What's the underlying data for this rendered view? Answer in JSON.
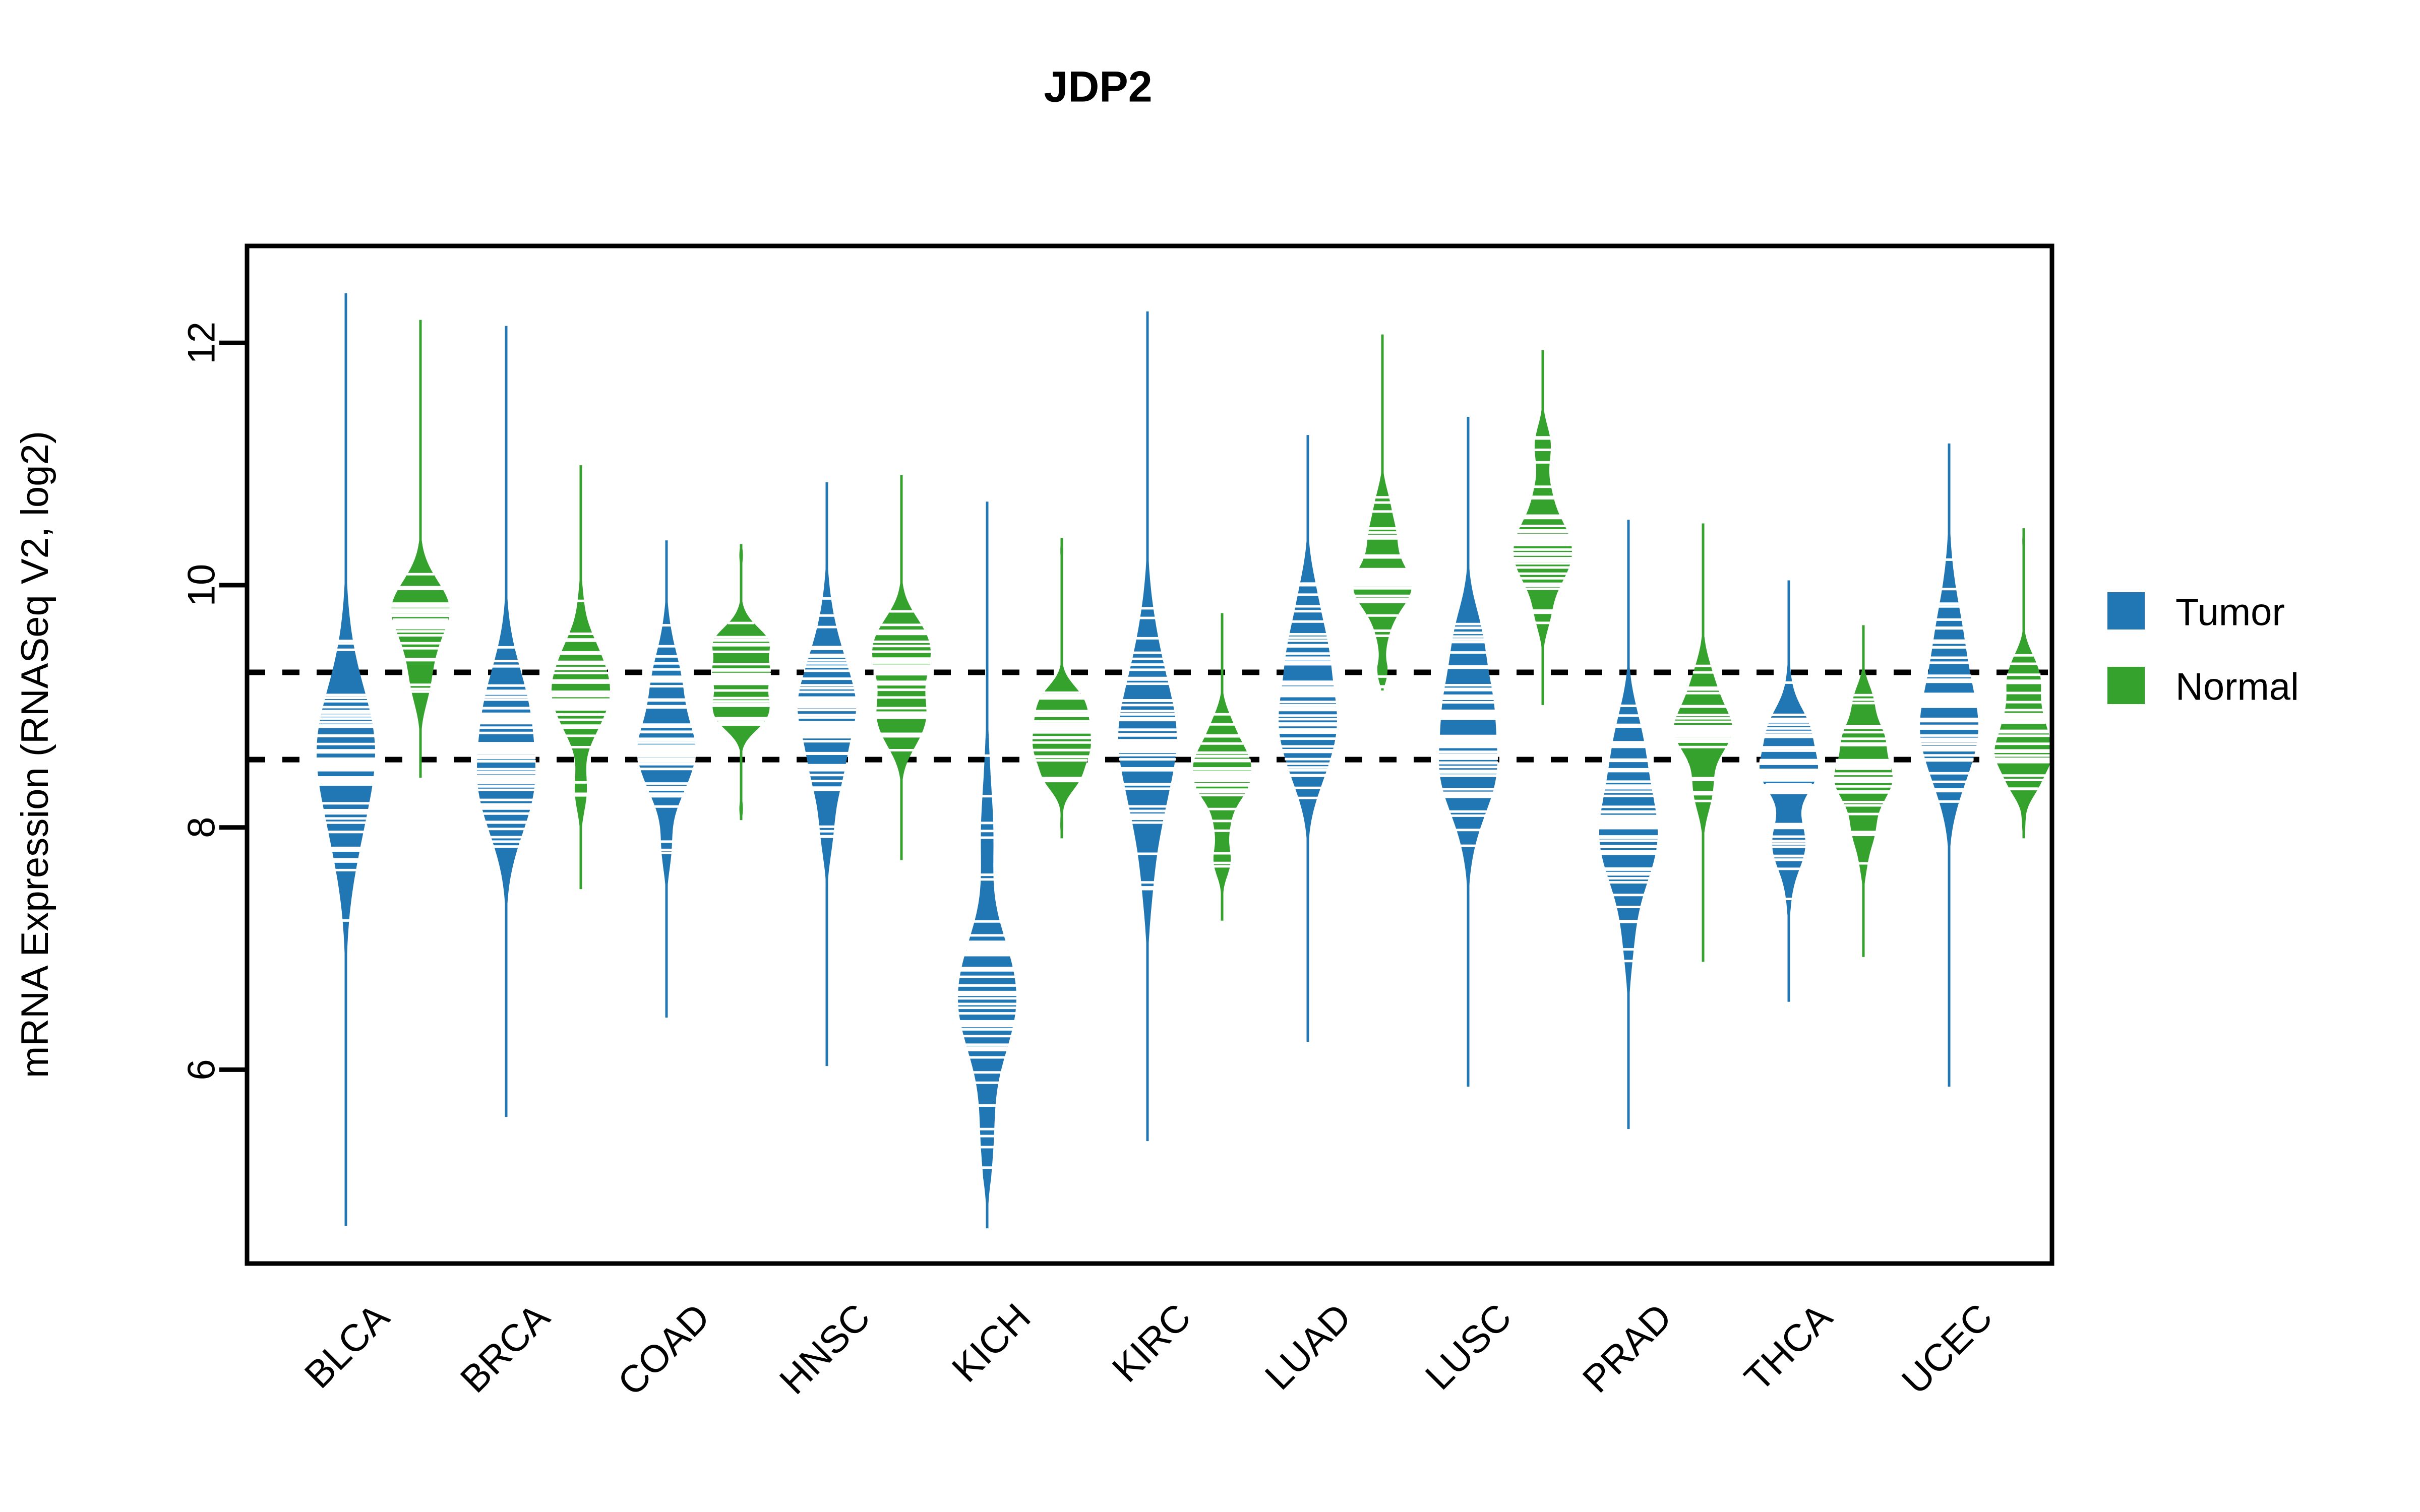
{
  "chart": {
    "title": "JDP2",
    "ylabel": "mRNA Expression (RNASeq V2, log2)",
    "xlabel": ""
  },
  "legend": {
    "position": "right",
    "items": [
      {
        "label": "Tumor",
        "color": "#2077b4"
      },
      {
        "label": "Normal",
        "color": "#34a22c"
      }
    ]
  },
  "axis": {
    "y_ticks": [
      "6",
      "8",
      "10",
      "12"
    ]
  },
  "chart_data": {
    "type": "violin",
    "title": "JDP2",
    "xlabel": "",
    "ylabel": "mRNA Expression (RNASeq V2, log2)",
    "ylim": [
      4.4,
      12.8
    ],
    "yticks": [
      6,
      8,
      10,
      12
    ],
    "grid": false,
    "legend_position": "right",
    "legend": [
      "Tumor",
      "Normal"
    ],
    "colors": {
      "Tumor": "#2077b4",
      "Normal": "#34a22c"
    },
    "reference_lines": [
      {
        "value": 9.28,
        "style": "dashed",
        "color": "#000000"
      },
      {
        "value": 8.56,
        "style": "dashed",
        "color": "#000000"
      }
    ],
    "categories": [
      "BLCA",
      "BRCA",
      "COAD",
      "HNSC",
      "KICH",
      "KIRC",
      "LUAD",
      "LUSC",
      "PRAD",
      "THCA",
      "UCEC"
    ],
    "series": [
      {
        "name": "Tumor",
        "color": "#2077b4",
        "stats": [
          {
            "category": "BLCA",
            "median": 8.52,
            "q1": 7.95,
            "q3": 9.18,
            "min": 4.7,
            "max": 12.42,
            "density_peak": 8.55,
            "n_points": 52
          },
          {
            "category": "BRCA",
            "median": 8.66,
            "q1": 8.1,
            "q3": 9.22,
            "min": 5.6,
            "max": 12.15,
            "density_peak": 8.7,
            "n_points": 56
          },
          {
            "category": "COAD",
            "median": 8.63,
            "q1": 8.12,
            "q3": 9.22,
            "min": 6.42,
            "max": 10.38,
            "density_peak": 8.68,
            "n_points": 46
          },
          {
            "category": "HNSC",
            "median": 8.78,
            "q1": 8.25,
            "q3": 9.32,
            "min": 6.02,
            "max": 10.86,
            "density_peak": 8.82,
            "n_points": 50
          },
          {
            "category": "KICH",
            "median": 7.02,
            "q1": 6.35,
            "q3": 8.05,
            "min": 4.68,
            "max": 10.7,
            "density_peak": 6.8,
            "n_points": 48
          },
          {
            "category": "KIRC",
            "median": 8.66,
            "q1": 8.12,
            "q3": 9.28,
            "min": 5.4,
            "max": 12.27,
            "density_peak": 8.7,
            "n_points": 50
          },
          {
            "category": "LUAD",
            "median": 9.12,
            "q1": 8.55,
            "q3": 9.65,
            "min": 6.22,
            "max": 11.25,
            "density_peak": 9.15,
            "n_points": 50
          },
          {
            "category": "LUSC",
            "median": 8.7,
            "q1": 8.15,
            "q3": 9.3,
            "min": 5.85,
            "max": 11.4,
            "density_peak": 8.72,
            "n_points": 50
          },
          {
            "category": "PRAD",
            "median": 8.03,
            "q1": 7.5,
            "q3": 8.6,
            "min": 5.5,
            "max": 10.55,
            "density_peak": 8.05,
            "n_points": 52
          },
          {
            "category": "THCA",
            "median": 8.32,
            "q1": 7.9,
            "q3": 8.8,
            "min": 6.55,
            "max": 10.05,
            "density_peak": 8.34,
            "n_points": 48
          },
          {
            "category": "UCEC",
            "median": 9.05,
            "q1": 8.55,
            "q3": 9.6,
            "min": 5.85,
            "max": 11.18,
            "density_peak": 9.08,
            "n_points": 52
          }
        ]
      },
      {
        "name": "Normal",
        "color": "#34a22c",
        "stats": [
          {
            "category": "BLCA",
            "median": 9.68,
            "q1": 9.3,
            "q3": 10.05,
            "min": 8.4,
            "max": 12.2,
            "density_peak": 9.66,
            "n_points": 22
          },
          {
            "category": "BRCA",
            "median": 9.02,
            "q1": 8.62,
            "q3": 9.48,
            "min": 7.48,
            "max": 11.0,
            "density_peak": 9.0,
            "n_points": 34
          },
          {
            "category": "COAD",
            "median": 9.22,
            "q1": 8.92,
            "q3": 9.52,
            "min": 8.05,
            "max": 10.35,
            "density_peak": 9.2,
            "n_points": 24
          },
          {
            "category": "HNSC",
            "median": 9.3,
            "q1": 8.95,
            "q3": 9.65,
            "min": 7.72,
            "max": 10.92,
            "density_peak": 9.28,
            "n_points": 28
          },
          {
            "category": "KICH",
            "median": 8.82,
            "q1": 8.48,
            "q3": 9.12,
            "min": 7.9,
            "max": 10.4,
            "density_peak": 8.8,
            "n_points": 22
          },
          {
            "category": "KIRC",
            "median": 8.42,
            "q1": 8.05,
            "q3": 8.78,
            "min": 7.22,
            "max": 9.78,
            "density_peak": 8.4,
            "n_points": 28
          },
          {
            "category": "LUAD",
            "median": 10.05,
            "q1": 9.68,
            "q3": 10.52,
            "min": 9.12,
            "max": 12.08,
            "density_peak": 10.02,
            "n_points": 34
          },
          {
            "category": "LUSC",
            "median": 10.38,
            "q1": 9.9,
            "q3": 10.82,
            "min": 9.0,
            "max": 11.95,
            "density_peak": 10.35,
            "n_points": 34
          },
          {
            "category": "PRAD",
            "median": 8.8,
            "q1": 8.45,
            "q3": 9.15,
            "min": 6.88,
            "max": 10.52,
            "density_peak": 8.78,
            "n_points": 28
          },
          {
            "category": "THCA",
            "median": 8.52,
            "q1": 8.2,
            "q3": 8.9,
            "min": 6.92,
            "max": 9.68,
            "density_peak": 8.5,
            "n_points": 30
          },
          {
            "category": "UCEC",
            "median": 8.9,
            "q1": 8.55,
            "q3": 9.28,
            "min": 7.9,
            "max": 10.48,
            "density_peak": 8.88,
            "n_points": 26
          }
        ]
      }
    ]
  },
  "geometry": {
    "plot_left": 490,
    "plot_right": 4070,
    "plot_top": 488,
    "plot_bottom": 2507,
    "y_min": 4.4,
    "y_max": 12.8,
    "group_first_center": 760,
    "group_spacing": 318,
    "pair_offset": 74,
    "half_width": 58
  }
}
